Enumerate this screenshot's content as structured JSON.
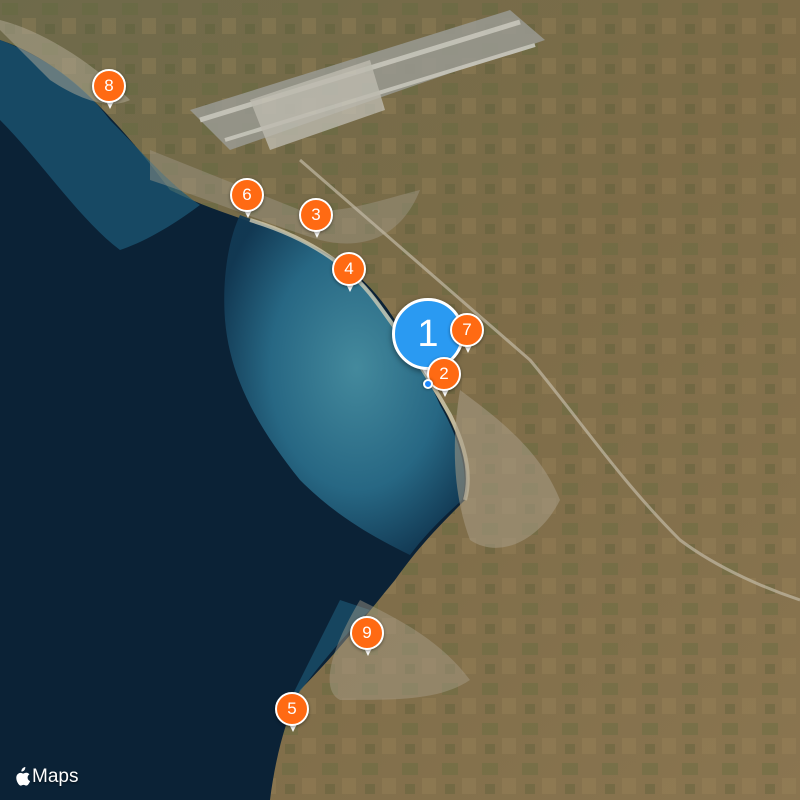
{
  "map": {
    "style": "satellite",
    "colors": {
      "deep_sea": "#0a1f33",
      "shallow_sea": "#2f7b94",
      "land": "#7a6a47",
      "pin": "#ff6a13",
      "cluster": "#2a9af2",
      "user_location": "#1e88ff"
    }
  },
  "cluster": {
    "label": "1"
  },
  "pins": [
    {
      "id": "pin-8",
      "label": "8"
    },
    {
      "id": "pin-6",
      "label": "6"
    },
    {
      "id": "pin-3",
      "label": "3"
    },
    {
      "id": "pin-4",
      "label": "4"
    },
    {
      "id": "pin-7",
      "label": "7"
    },
    {
      "id": "pin-2",
      "label": "2"
    },
    {
      "id": "pin-9",
      "label": "9"
    },
    {
      "id": "pin-5",
      "label": "5"
    }
  ],
  "attribution": {
    "brand_icon": "apple-logo-icon",
    "label": "Maps"
  }
}
